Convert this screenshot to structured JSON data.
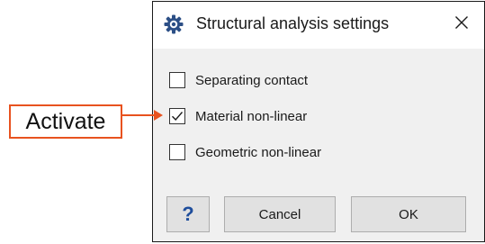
{
  "dialog": {
    "title": "Structural analysis settings",
    "title_icon": "gear-icon",
    "close_icon": "close-icon",
    "options": [
      {
        "label": "Separating contact",
        "checked": false
      },
      {
        "label": "Material non-linear",
        "checked": true
      },
      {
        "label": "Geometric non-linear",
        "checked": false
      }
    ],
    "buttons": {
      "help": "?",
      "cancel": "Cancel",
      "ok": "OK"
    }
  },
  "callout": {
    "label": "Activate",
    "color": "#e8521f"
  }
}
